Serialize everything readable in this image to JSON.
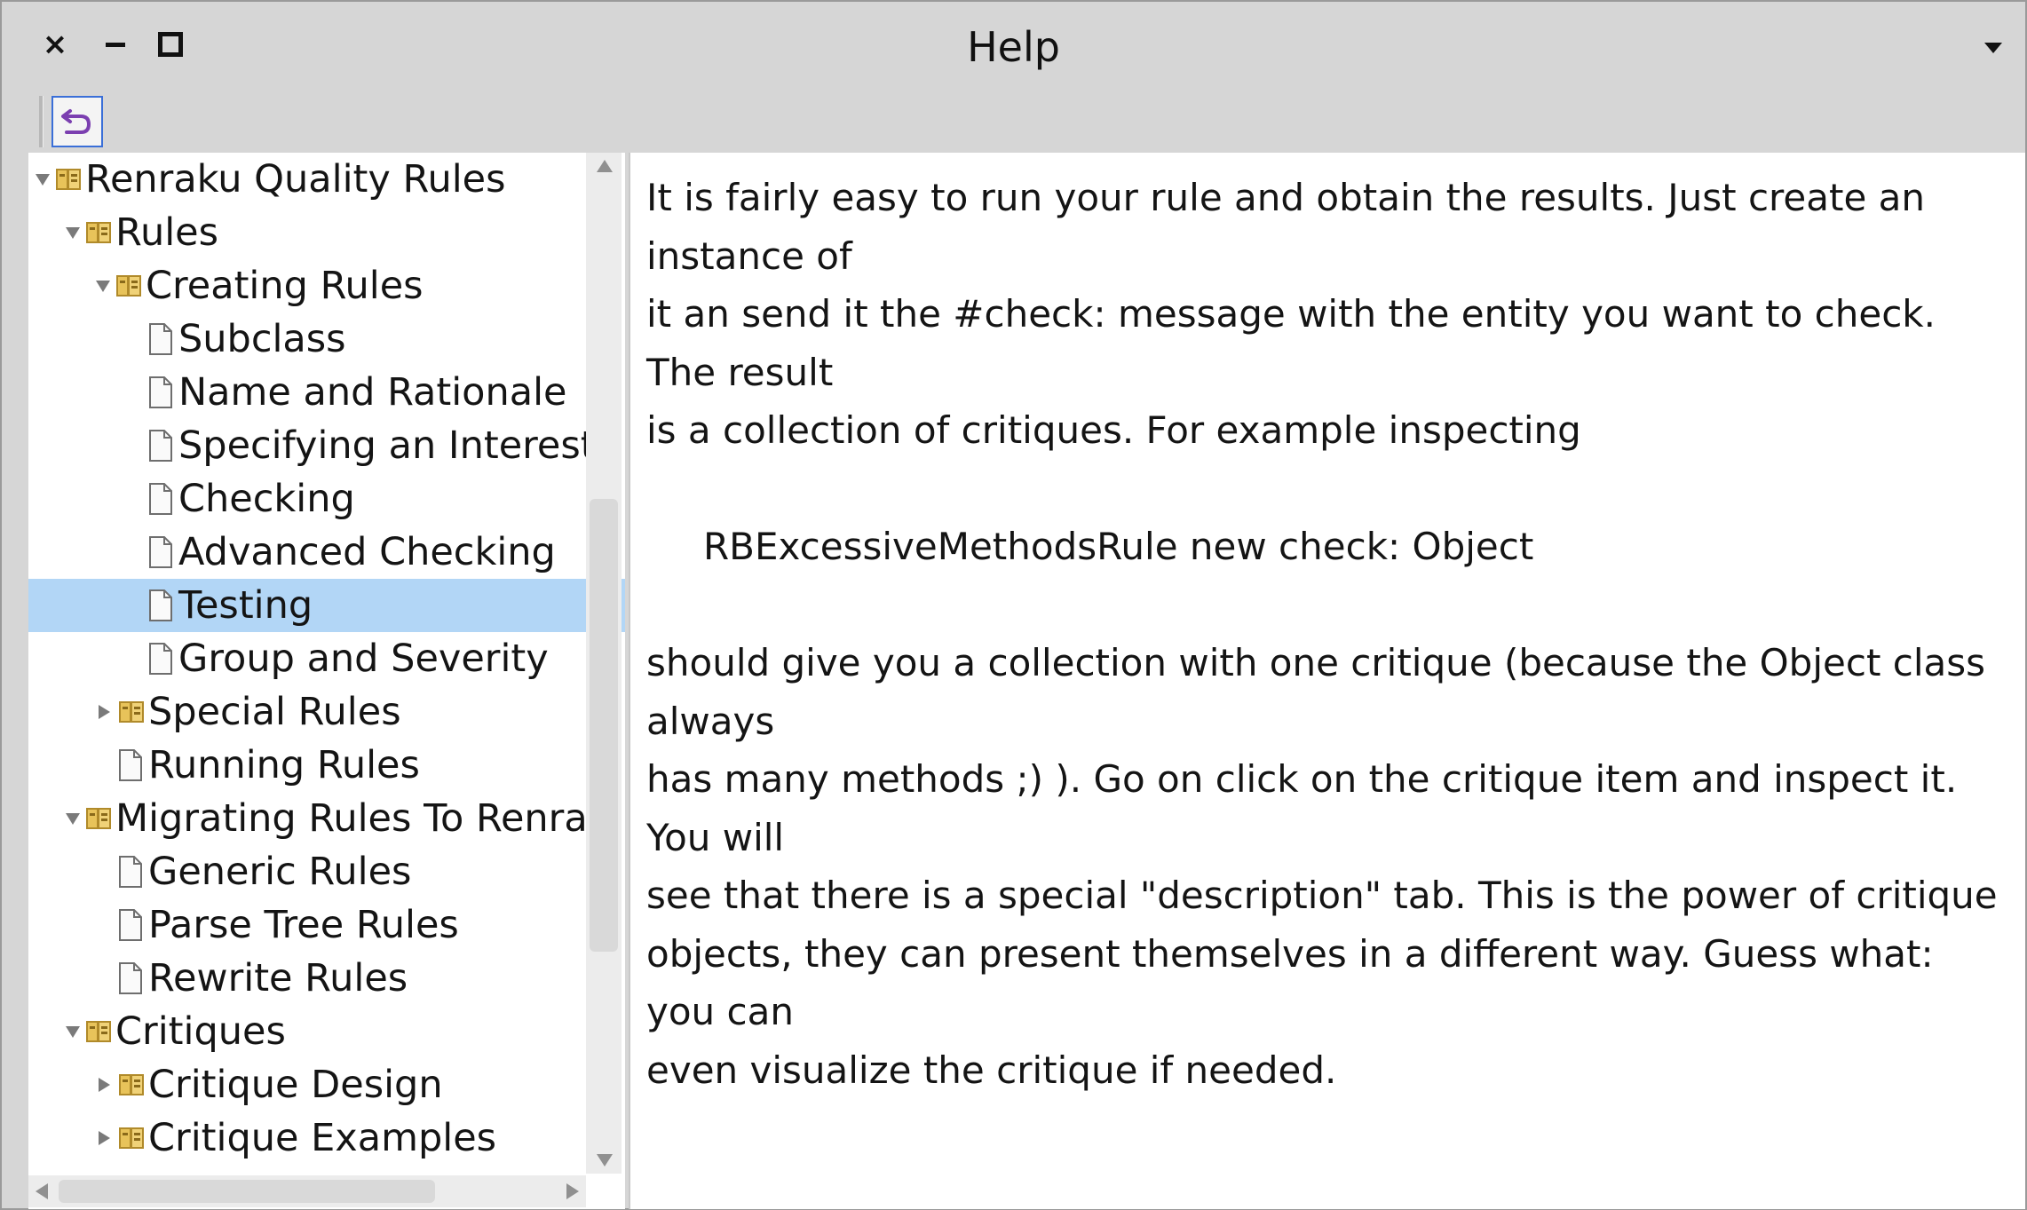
{
  "window": {
    "title": "Help",
    "close_glyph": "×",
    "close_icon": "close-icon",
    "minimize_icon": "minimize-icon",
    "maximize_icon": "maximize-icon",
    "menu_icon": "dropdown-menu-icon"
  },
  "toolbar": {
    "back_icon": "back-arrow-icon",
    "accent_color": "#7b3fb0"
  },
  "tree": {
    "selected_color": "#b2d6f6",
    "items": [
      {
        "label": "Renraku Quality Rules",
        "type": "book",
        "expanded": true,
        "level": 0
      },
      {
        "label": "Rules",
        "type": "book",
        "expanded": true,
        "level": 1
      },
      {
        "label": "Creating Rules",
        "type": "book",
        "expanded": true,
        "level": 2
      },
      {
        "label": "Subclass",
        "type": "page",
        "level": 3
      },
      {
        "label": "Name and Rationale",
        "type": "page",
        "level": 3
      },
      {
        "label": "Specifying an Interest",
        "type": "page",
        "level": 3
      },
      {
        "label": "Checking",
        "type": "page",
        "level": 3
      },
      {
        "label": "Advanced Checking",
        "type": "page",
        "level": 3
      },
      {
        "label": "Testing",
        "type": "page",
        "level": 3,
        "selected": true
      },
      {
        "label": "Group and Severity",
        "type": "page",
        "level": 3
      },
      {
        "label": "Special Rules",
        "type": "book",
        "expanded": false,
        "level": 2
      },
      {
        "label": "Running Rules",
        "type": "page",
        "level": 2
      },
      {
        "label": "Migrating Rules To Renrak",
        "type": "book",
        "expanded": true,
        "level": 1
      },
      {
        "label": "Generic Rules",
        "type": "page",
        "level": 2
      },
      {
        "label": "Parse Tree Rules",
        "type": "page",
        "level": 2
      },
      {
        "label": "Rewrite Rules",
        "type": "page",
        "level": 2
      },
      {
        "label": "Critiques",
        "type": "book",
        "expanded": true,
        "level": 1
      },
      {
        "label": "Critique Design",
        "type": "book",
        "expanded": false,
        "level": 2
      },
      {
        "label": "Critique Examples",
        "type": "book",
        "expanded": false,
        "level": 2
      }
    ]
  },
  "content": {
    "lines_p1": [
      "It is fairly easy to run your rule and obtain the results. Just create an instance of",
      "it an send it the #check: message with the entity you want to check. The result",
      "is a collection of critiques. For example inspecting"
    ],
    "code": "RBExcessiveMethodsRule new check: Object",
    "lines_p2": [
      "should give you a collection with one critique (because the Object class always",
      "has many methods ;) ). Go on click on the critique item and inspect it. You will",
      "see that there is a special \"description\" tab. This is the power of critique",
      "objects, they can present themselves in a different way. Guess what: you can",
      "even visualize the critique if needed."
    ]
  }
}
